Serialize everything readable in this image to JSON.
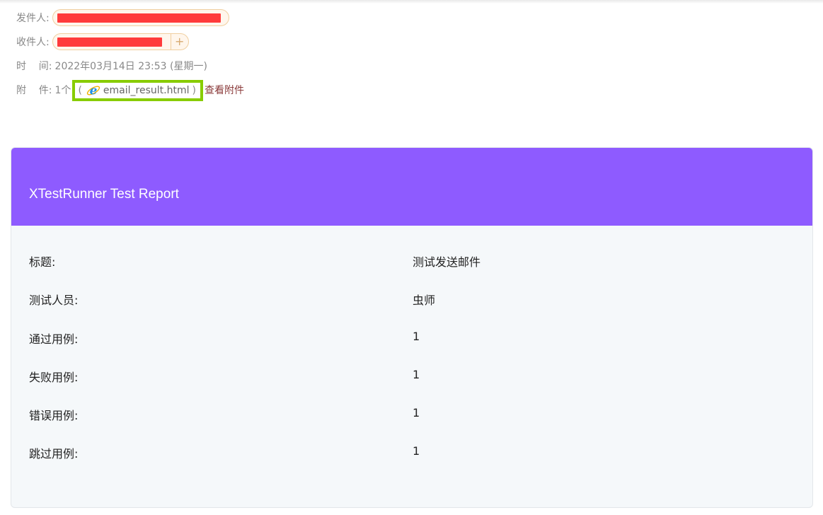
{
  "email": {
    "sender_label": "发件人:",
    "recipient_label": "收件人:",
    "recipient_add": "+",
    "time_label": "时    间:",
    "time_value": "2022年03月14日 23:53 (星期一)",
    "attachment_label": "附    件:",
    "attachment_count": "1个",
    "attachment_open_paren": "(",
    "attachment_close_paren": ")",
    "attachment_icon": "ie-file-icon",
    "attachment_name": "email_result.html",
    "view_attachment": "查看附件"
  },
  "colors": {
    "redaction": "#ff3b3b",
    "highlight_box": "#88cc00",
    "report_header": "#8e5bff",
    "link": "#8a3a3a"
  },
  "report": {
    "title": "XTestRunner Test Report",
    "rows": [
      {
        "label": "标题:",
        "value": "测试发送邮件"
      },
      {
        "label": "测试人员:",
        "value": "虫师"
      },
      {
        "label": "通过用例:",
        "value": "1"
      },
      {
        "label": "失败用例:",
        "value": "1"
      },
      {
        "label": "错误用例:",
        "value": "1"
      },
      {
        "label": "跳过用例:",
        "value": "1"
      }
    ]
  }
}
